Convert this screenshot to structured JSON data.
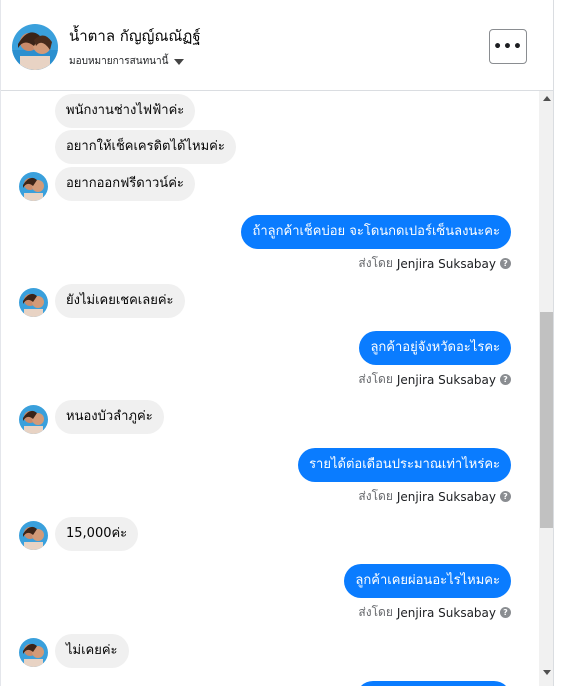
{
  "header": {
    "contact_name": "น้ำตาล กัญญ์ณณัฏฐ์",
    "assign_label": "มอบหมายการสนทนานี้",
    "more_label": "•••"
  },
  "messages": {
    "in_1": "พนักงานช่างไฟฟ้าค่ะ",
    "in_2": "อยากให้เช็คเครดิตได้ไหมค่ะ",
    "in_3": "อยากออกฟรีดาวน์ค่ะ",
    "out_1": "ถ้าลูกค้าเช็คบ่อย จะโดนกดเปอร์เซ็นลงนะคะ",
    "in_4": "ยังไม่เคยเชคเลยค่ะ",
    "out_2": "ลูกค้าอยู่จังหวัดอะไรคะ",
    "in_5": "หนองบัวลำภูค่ะ",
    "out_3": "รายได้ต่อเดือนประมาณเท่าไหร่คะ",
    "in_6": "15,000ค่ะ",
    "out_4": "ลูกค้าเคยผ่อนอะไรไหมคะ",
    "in_7": "ไม่เคยค่ะ"
  },
  "sent_by": {
    "prefix": "ส่งโดย",
    "name": "Jenjira Suksabay",
    "help": "?"
  },
  "colors": {
    "outgoing_bubble": "#0a7cff",
    "incoming_bubble": "#f0f0f0"
  }
}
